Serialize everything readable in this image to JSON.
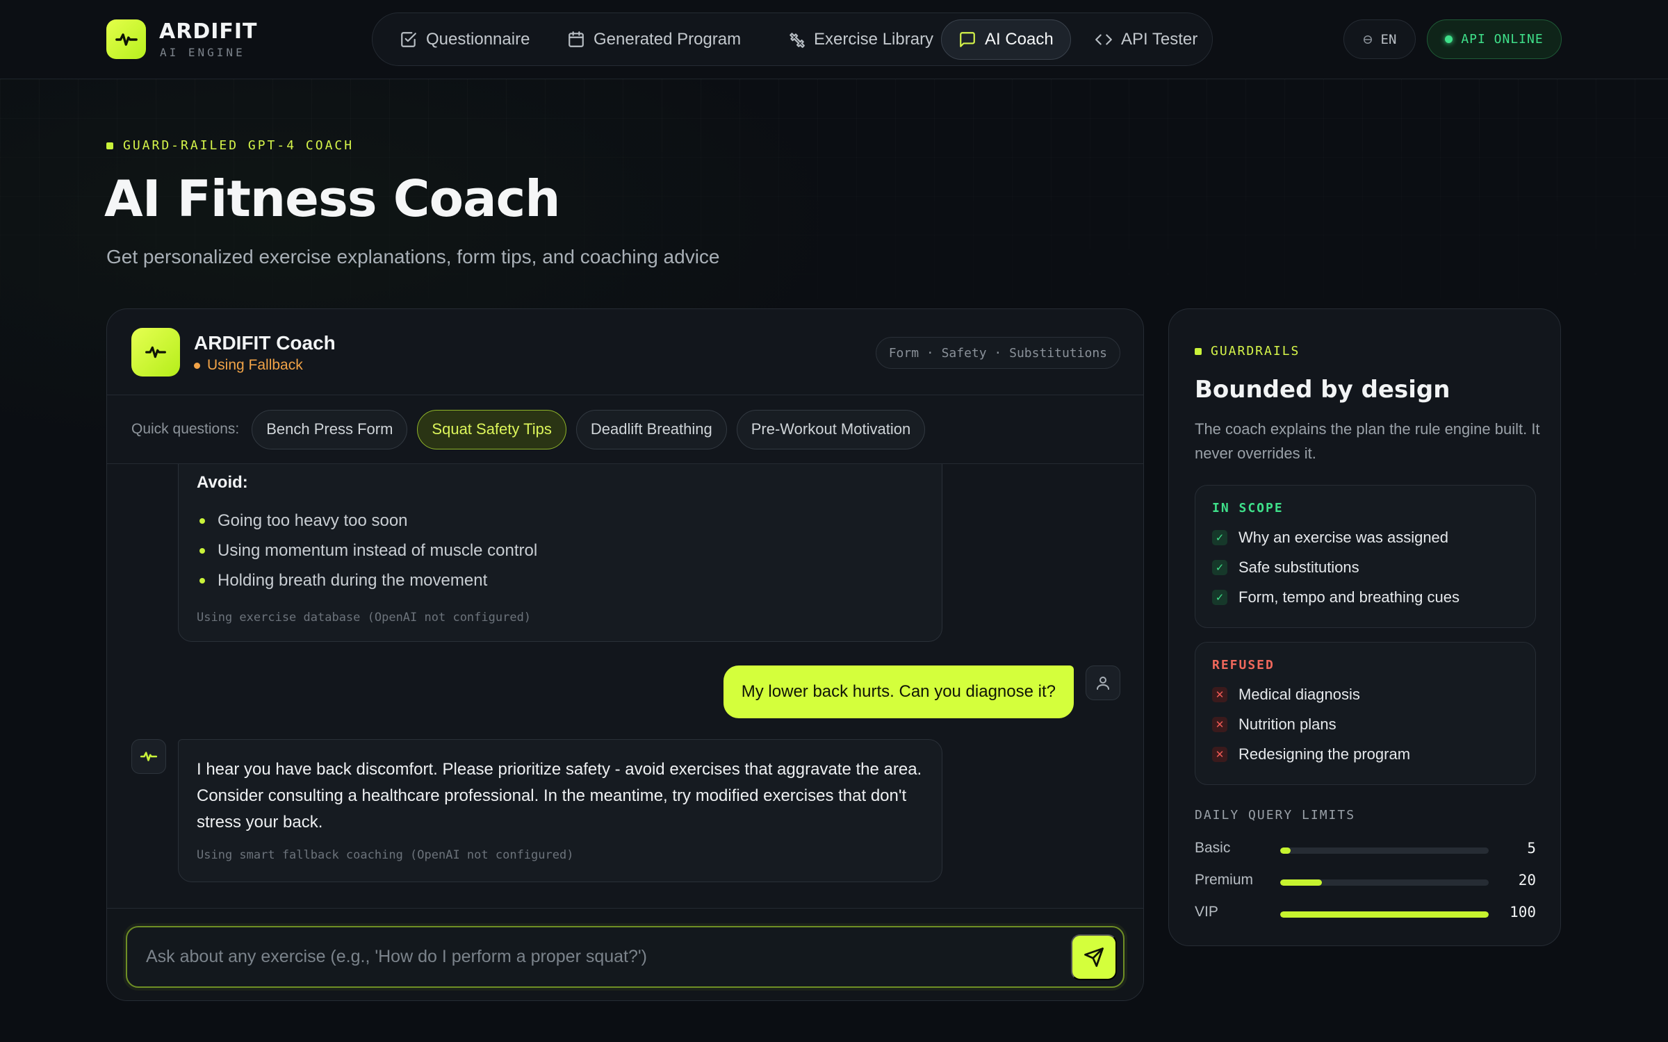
{
  "brand": {
    "name": "ARDIFIT",
    "subtitle": "AI ENGINE"
  },
  "nav": {
    "items": [
      {
        "label": "Questionnaire",
        "icon": "checkbox-icon",
        "active": false
      },
      {
        "label": "Generated Program",
        "icon": "calendar-icon",
        "active": false
      },
      {
        "label": "Exercise Library",
        "icon": "dumbbell-icon",
        "active": false
      },
      {
        "label": "AI Coach",
        "icon": "chat-bubble-icon",
        "active": true
      },
      {
        "label": "API Tester",
        "icon": "code-icon",
        "active": false
      }
    ]
  },
  "language": {
    "label": "EN",
    "icon": "globe-icon"
  },
  "api_status": {
    "label": "API ONLINE",
    "color": "#3fe08a"
  },
  "hero": {
    "eyebrow": "GUARD-RAILED GPT-4 COACH",
    "title": "AI Fitness Coach",
    "subtitle": "Get personalized exercise explanations, form tips, and coaching advice"
  },
  "chat": {
    "coach_name": "ARDIFIT Coach",
    "status": "Using Fallback",
    "status_color": "#f1a347",
    "topic_tags": "Form · Safety · Substitutions",
    "quick_label": "Quick questions:",
    "quick_questions": [
      {
        "label": "Bench Press Form",
        "highlighted": false
      },
      {
        "label": "Squat Safety Tips",
        "highlighted": true
      },
      {
        "label": "Deadlift Breathing",
        "highlighted": false
      },
      {
        "label": "Pre-Workout Motivation",
        "highlighted": false
      }
    ],
    "messages": [
      {
        "role": "bot",
        "heading": "Avoid:",
        "bullets": [
          "Going too heavy too soon",
          "Using momentum instead of muscle control",
          "Holding breath during the movement"
        ],
        "meta": "Using exercise database (OpenAI not configured)"
      },
      {
        "role": "user",
        "text": "My lower back hurts. Can you diagnose it?"
      },
      {
        "role": "bot",
        "text": "I hear you have back discomfort. Please prioritize safety - avoid exercises that aggravate the area. Consider consulting a healthcare professional. In the meantime, try modified exercises that don't stress your back.",
        "meta": "Using smart fallback coaching (OpenAI not configured)"
      }
    ],
    "input": {
      "value": "",
      "placeholder": "Ask about any exercise (e.g., 'How do I perform a proper squat?')"
    }
  },
  "guardrails": {
    "eyebrow": "GUARDRAILS",
    "title": "Bounded by design",
    "description": "The coach explains the plan the rule engine built. It never overrides it.",
    "in_scope": {
      "title": "IN SCOPE",
      "color": "#3fe08a",
      "items": [
        "Why an exercise was assigned",
        "Safe substitutions",
        "Form, tempo and breathing cues"
      ]
    },
    "refused": {
      "title": "REFUSED",
      "color": "#f0685c",
      "items": [
        "Medical diagnosis",
        "Nutrition plans",
        "Redesigning the program"
      ]
    },
    "limits": {
      "title": "DAILY QUERY LIMITS",
      "tiers": [
        {
          "name": "Basic",
          "value": "5",
          "fraction": 0.05
        },
        {
          "name": "Premium",
          "value": "20",
          "fraction": 0.2
        },
        {
          "name": "VIP",
          "value": "100",
          "fraction": 1.0
        }
      ]
    }
  },
  "colors": {
    "accent": "#d4ff3c",
    "background": "#0b0e13",
    "card": "#12161c"
  }
}
